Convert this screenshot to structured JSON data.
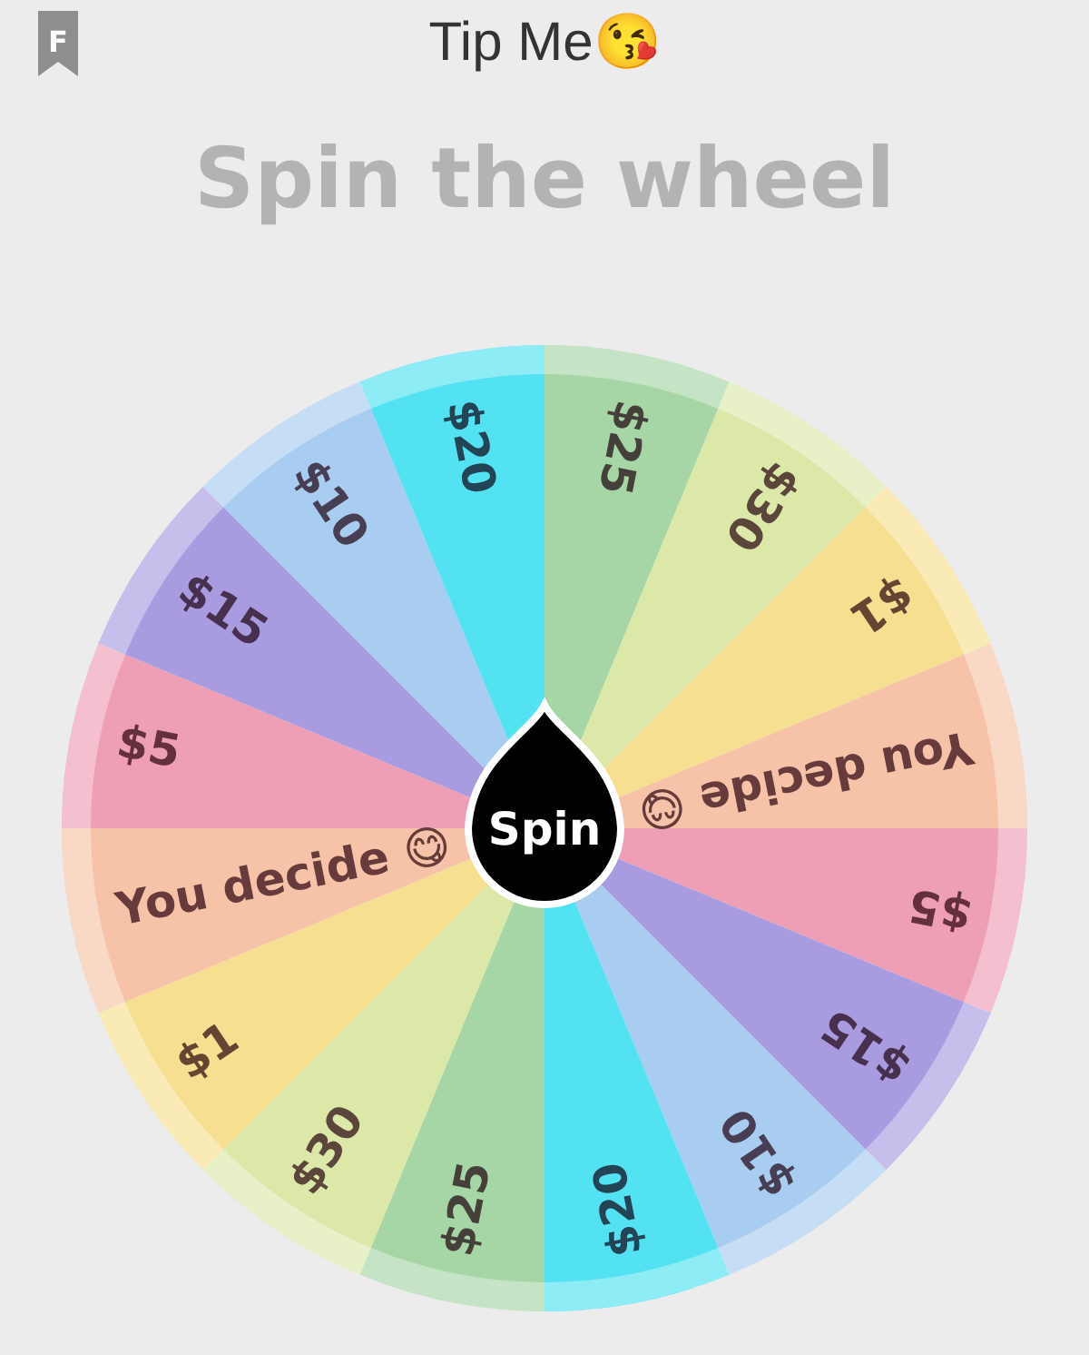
{
  "bookmark": {
    "letter": "F"
  },
  "title": "Tip Me😘",
  "heading": "Spin the wheel",
  "wheel": {
    "segments": [
      {
        "label": "$25",
        "color": "#a6d6a6"
      },
      {
        "label": "$30",
        "color": "#dbe8a8"
      },
      {
        "label": "$1",
        "color": "#f6df90"
      },
      {
        "label": "You decide 😋",
        "color": "#f6c3a8"
      },
      {
        "label": "$5",
        "color": "#ee9fb5"
      },
      {
        "label": "$15",
        "color": "#a89be0"
      },
      {
        "label": "$10",
        "color": "#a8cdf0"
      },
      {
        "label": "$20",
        "color": "#52e2f2"
      },
      {
        "label": "$25",
        "color": "#a6d6a6"
      },
      {
        "label": "$30",
        "color": "#dbe8a8"
      },
      {
        "label": "$1",
        "color": "#f6df90"
      },
      {
        "label": "You decide 😋",
        "color": "#f6c3a8"
      },
      {
        "label": "$5",
        "color": "#ee9fb5"
      },
      {
        "label": "$15",
        "color": "#a89be0"
      },
      {
        "label": "$10",
        "color": "#a8cdf0"
      },
      {
        "label": "$20",
        "color": "#52e2f2"
      }
    ],
    "spin_button": "Spin"
  }
}
